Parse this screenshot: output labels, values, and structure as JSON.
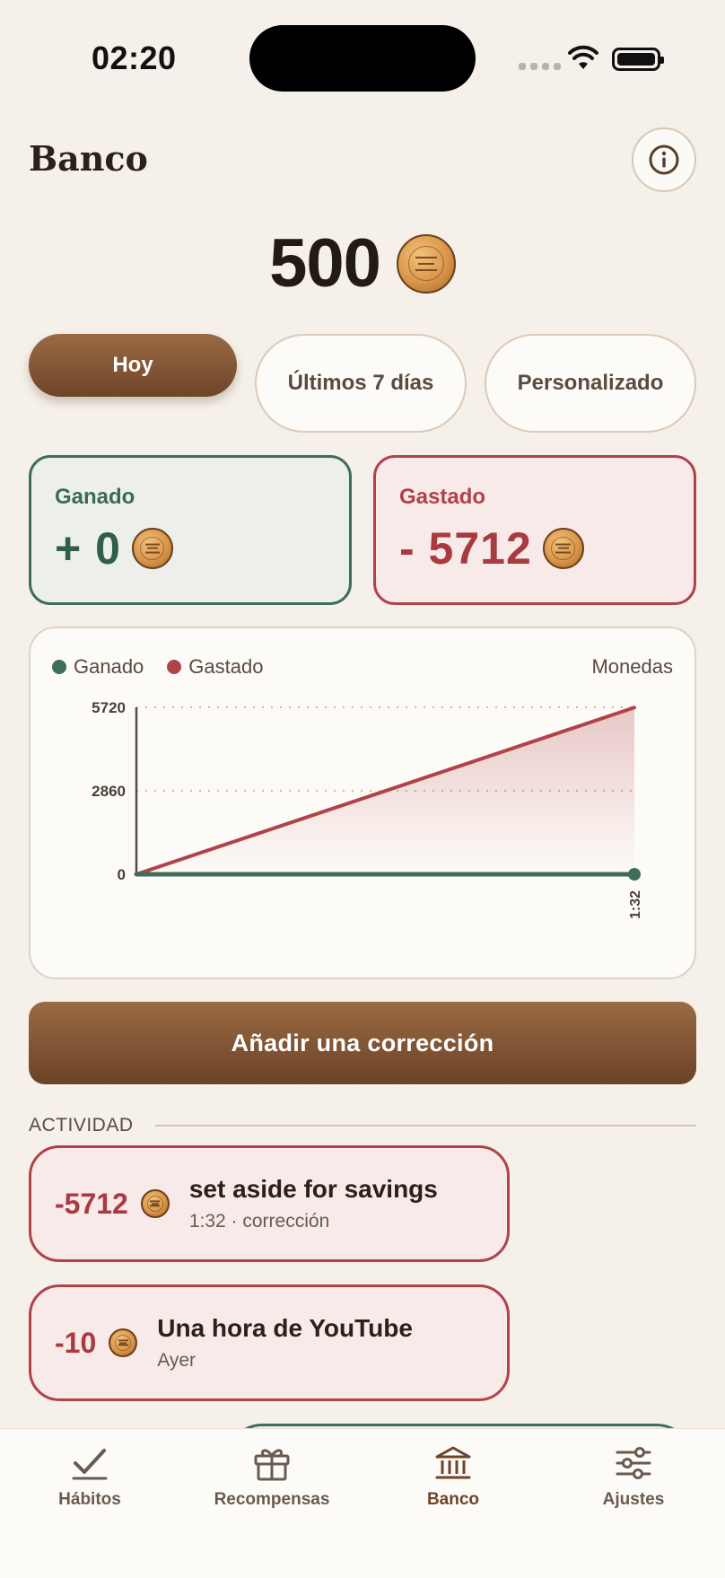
{
  "status_bar": {
    "time": "02:20"
  },
  "header": {
    "title": "Banco"
  },
  "balance": {
    "value": "500"
  },
  "tabs": [
    {
      "label": "Hoy",
      "active": true
    },
    {
      "label": "Últimos 7 días",
      "active": false
    },
    {
      "label": "Personalizado",
      "active": false
    }
  ],
  "stats": {
    "earned": {
      "label": "Ganado",
      "value": "+ 0"
    },
    "spent": {
      "label": "Gastado",
      "value": "- 5712"
    }
  },
  "chart_panel": {
    "legend": [
      "Ganado",
      "Gastado"
    ],
    "unit": "Monedas"
  },
  "chart_data": {
    "type": "line",
    "x": [
      "0:00",
      "1:32"
    ],
    "x_tick_labels": [
      "1:32"
    ],
    "y_ticks": [
      "0",
      "2860",
      "5720"
    ],
    "ylim": [
      0,
      5720
    ],
    "grid": true,
    "legend_placement": "top-left",
    "series": [
      {
        "name": "Ganado",
        "color": "#3f6e58",
        "values": [
          0,
          0
        ]
      },
      {
        "name": "Gastado",
        "color": "#b0434a",
        "values": [
          0,
          5712
        ]
      }
    ]
  },
  "correction_button": {
    "label": "Añadir una corrección"
  },
  "activity": {
    "title": "ACTIVIDAD",
    "items": [
      {
        "amount": "-5712",
        "title": "set aside for savings",
        "subtitle": "1:32 · corrección"
      },
      {
        "amount": "-10",
        "title": "Una hora de YouTube",
        "subtitle": "Ayer"
      }
    ]
  },
  "nav": [
    {
      "label": "Hábitos",
      "icon": "check-icon",
      "active": false
    },
    {
      "label": "Recompensas",
      "icon": "gift-icon",
      "active": false
    },
    {
      "label": "Banco",
      "icon": "bank-icon",
      "active": true
    },
    {
      "label": "Ajustes",
      "icon": "sliders-icon",
      "active": false
    }
  ],
  "colors": {
    "earned": "#3f6e58",
    "spent": "#b0434a",
    "brand_brown": "#7a4f30",
    "background": "#f5f0e9"
  }
}
